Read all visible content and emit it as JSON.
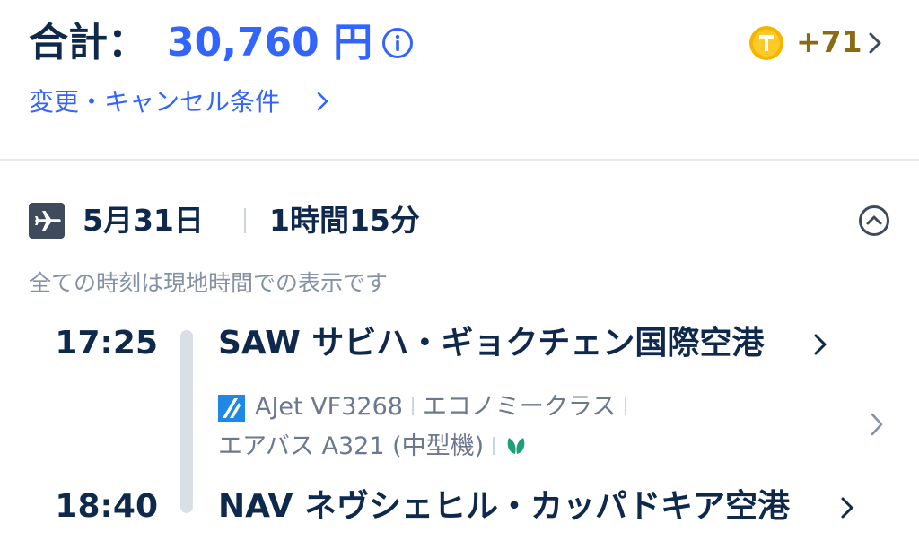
{
  "header": {
    "total_label": "合計：",
    "total_amount": "30,760 円",
    "points": "+71",
    "cancel_link": "変更・キャンセル条件"
  },
  "flight": {
    "date": "5月31日",
    "duration": "1時間15分",
    "timezone_note": "全ての時刻は現地時間での表示です",
    "departure": {
      "time": "17:25",
      "airport": "SAW  サビハ・ギョクチェン国際空港"
    },
    "arrival": {
      "time": "18:40",
      "airport": "NAV  ネヴシェヒル・カッパドキア空港"
    },
    "airline": "AJet VF3268",
    "cabin": "エコノミークラス",
    "aircraft": "エアバス A321 (中型機)"
  },
  "colors": {
    "accent": "#3264ff",
    "text_dark": "#0f294d",
    "text_muted": "#6b7890",
    "points_gold": "#8a6a14",
    "eco_green": "#1f9e78"
  },
  "icons": {
    "info": "info-icon",
    "coin": "coin-icon",
    "plane": "plane-icon",
    "collapse": "chevron-up-circle-icon",
    "airline_logo": "ajet-logo-icon",
    "eco": "leaf-icon"
  }
}
